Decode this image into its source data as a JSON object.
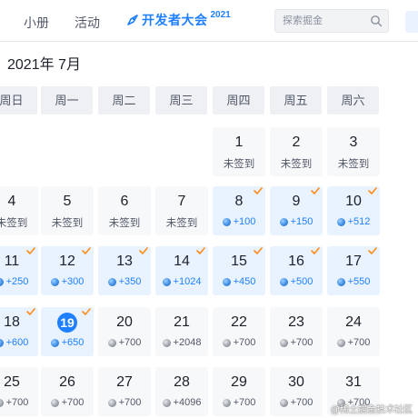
{
  "nav": {
    "items": [
      "小册",
      "活动"
    ],
    "devcon_text": "开发者大会",
    "devcon_year": "2021",
    "search_placeholder": "探索掘金"
  },
  "calendar": {
    "title": "2021年 7月",
    "weekdays": [
      "周日",
      "周一",
      "周二",
      "周三",
      "周四",
      "周五",
      "周六"
    ],
    "unsigned_label": "未签到",
    "days": [
      {
        "n": "1",
        "status": "未签到"
      },
      {
        "n": "2",
        "status": "未签到"
      },
      {
        "n": "3",
        "status": "未签到"
      },
      {
        "n": "4",
        "status": "未签到"
      },
      {
        "n": "5",
        "status": "未签到"
      },
      {
        "n": "6",
        "status": "未签到"
      },
      {
        "n": "7",
        "status": "未签到"
      },
      {
        "n": "8",
        "pts": "+100",
        "signed": true
      },
      {
        "n": "9",
        "pts": "+150",
        "signed": true
      },
      {
        "n": "10",
        "pts": "+512",
        "signed": true
      },
      {
        "n": "11",
        "pts": "+250",
        "signed": true
      },
      {
        "n": "12",
        "pts": "+300",
        "signed": true
      },
      {
        "n": "13",
        "pts": "+350",
        "signed": true
      },
      {
        "n": "14",
        "pts": "+1024",
        "signed": true
      },
      {
        "n": "15",
        "pts": "+450",
        "signed": true
      },
      {
        "n": "16",
        "pts": "+500",
        "signed": true
      },
      {
        "n": "17",
        "pts": "+550",
        "signed": true
      },
      {
        "n": "18",
        "pts": "+600",
        "signed": true
      },
      {
        "n": "19",
        "pts": "+650",
        "signed": true,
        "today": true
      },
      {
        "n": "20",
        "pts": "+700"
      },
      {
        "n": "21",
        "pts": "+2048"
      },
      {
        "n": "22",
        "pts": "+700"
      },
      {
        "n": "23",
        "pts": "+700"
      },
      {
        "n": "24",
        "pts": "+700"
      },
      {
        "n": "25",
        "pts": "+700"
      },
      {
        "n": "26",
        "pts": "+700"
      },
      {
        "n": "27",
        "pts": "+700"
      },
      {
        "n": "28",
        "pts": "+4096"
      },
      {
        "n": "29",
        "pts": "+700"
      },
      {
        "n": "30",
        "pts": "+700"
      },
      {
        "n": "31",
        "pts": "+700"
      }
    ]
  },
  "colors": {
    "accent": "#1e80ff",
    "signed_bg": "#e8f3ff",
    "unsigned_bg": "#f7f8fa",
    "check": "#ff8c1a"
  },
  "watermark": "@稀土掘金技术社区"
}
